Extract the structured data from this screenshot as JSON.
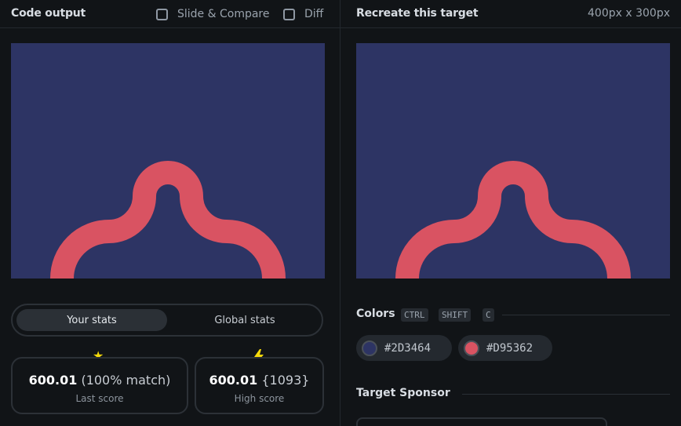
{
  "left_panel": {
    "title": "Code output",
    "slide_compare_label": "Slide & Compare",
    "diff_label": "Diff"
  },
  "right_panel": {
    "title": "Recreate this target",
    "dimensions": "400px x 300px"
  },
  "stats_toggle": {
    "your_stats": "Your stats",
    "global_stats": "Global stats"
  },
  "last_score": {
    "icon": "star-icon",
    "value": "600.01",
    "detail": "(100% match)",
    "label": "Last score"
  },
  "high_score": {
    "icon": "lightning-icon",
    "value": "600.01",
    "detail": "{1093}",
    "label": "High score"
  },
  "colors_section": {
    "title": "Colors",
    "shortcut_keys": [
      "CTRL",
      "SHIFT",
      "C"
    ],
    "swatches": [
      {
        "hex": "#2D3464",
        "label": "#2D3464"
      },
      {
        "hex": "#D95362",
        "label": "#D95362"
      }
    ]
  },
  "sponsor_section": {
    "title": "Target Sponsor"
  },
  "theme": {
    "background": "#2D3464",
    "shape": "#D95362",
    "star_color": "#f5d90a",
    "bolt_color": "#f5d90a"
  }
}
